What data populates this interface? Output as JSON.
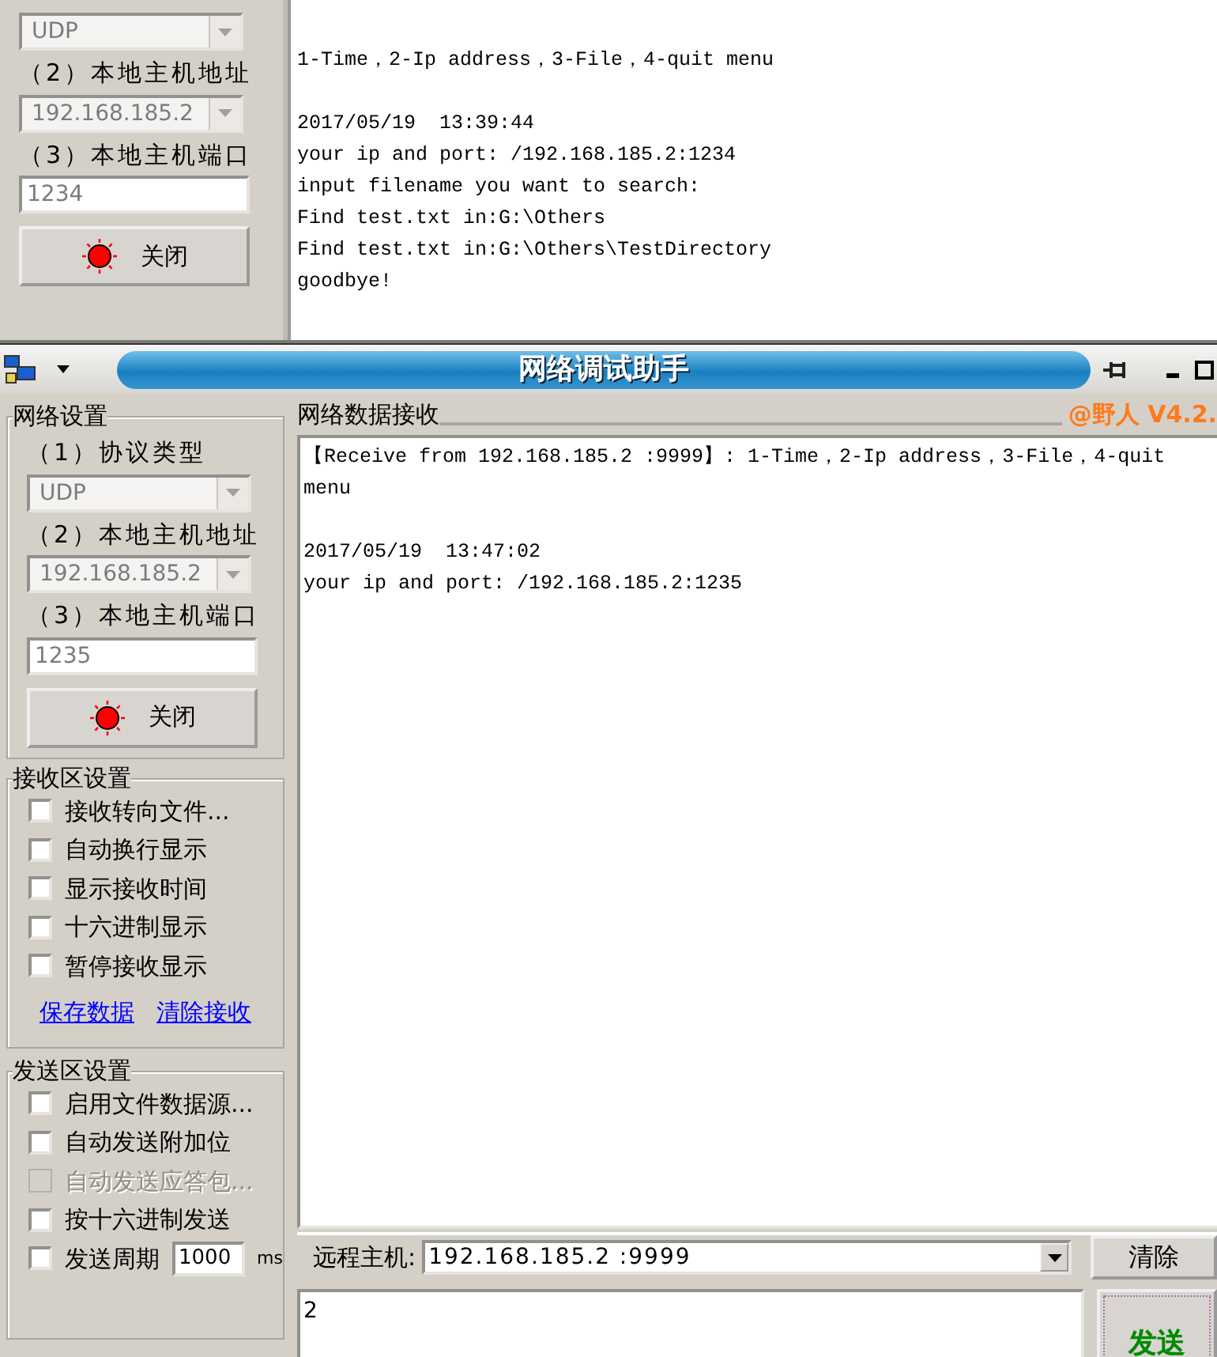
{
  "back_window": {
    "settings": [
      {
        "kind": "combo",
        "value": "UDP",
        "disabled": true
      },
      {
        "kind": "combo",
        "label": "（2）本地主机地址",
        "value": "192.168.185.2",
        "disabled": true
      },
      {
        "kind": "input",
        "label": "（3）本地主机端口",
        "value": "1234",
        "disabled": true
      }
    ],
    "toggle_button": {
      "label": "关闭",
      "on": true
    },
    "log": [
      [
        "1-Time，2-Ip address，3-File，4-quit menu"
      ],
      [
        "2017/05/19  13:39:44",
        "your ip and port: /192.168.185.2:1234",
        "input filename you want to search:",
        "Find test.txt in:G:\\Others",
        "Find test.txt in:G:\\Others\\TestDirectory",
        "goodbye!"
      ]
    ]
  },
  "front_window": {
    "title": "网络调试助手",
    "network_settings": {
      "title": "网络设置",
      "settings": [
        {
          "kind": "combo",
          "label": "（1）协议类型",
          "value": "UDP",
          "disabled": true
        },
        {
          "kind": "combo",
          "label": "（2）本地主机地址",
          "value": "192.168.185.2",
          "disabled": true
        },
        {
          "kind": "input",
          "label": "（3）本地主机端口",
          "value": "1235",
          "disabled": true
        }
      ],
      "toggle_button": {
        "label": "关闭",
        "on": true
      }
    },
    "receive_settings": {
      "title": "接收区设置",
      "options": [
        {
          "kind": "check",
          "label": "接收转向文件...",
          "checked": false,
          "disabled": false
        },
        {
          "kind": "check",
          "label": "自动换行显示",
          "checked": false,
          "disabled": false
        },
        {
          "kind": "check",
          "label": "显示接收时间",
          "checked": false,
          "disabled": false
        },
        {
          "kind": "check",
          "label": "十六进制显示",
          "checked": false,
          "disabled": false
        },
        {
          "kind": "check",
          "label": "暂停接收显示",
          "checked": false,
          "disabled": false
        }
      ],
      "links": [
        "保存数据",
        "清除接收"
      ]
    },
    "send_settings": {
      "title": "发送区设置",
      "options": [
        {
          "kind": "check",
          "label": "启用文件数据源...",
          "checked": false,
          "disabled": false
        },
        {
          "kind": "check",
          "label": "自动发送附加位",
          "checked": false,
          "disabled": false
        },
        {
          "kind": "check",
          "label": "自动发送应答包...",
          "checked": false,
          "disabled": true
        },
        {
          "kind": "check",
          "label": "按十六进制发送",
          "checked": false,
          "disabled": false
        },
        {
          "kind": "period",
          "label": "发送周期",
          "checked": false,
          "disabled": false,
          "value": "1000",
          "unit": "ms"
        }
      ]
    },
    "receive_area": {
      "title": "网络数据接收",
      "version": "@野人 V4.2.",
      "log": [
        [
          "【Receive from 192.168.185.2 :9999】: 1-Time，2-Ip address，3-File，4-quit menu"
        ],
        [
          "2017/05/19  13:47:02",
          "your ip and port: /192.168.185.2:1235"
        ]
      ]
    },
    "remote_host": {
      "label": "远程主机:",
      "value": "192.168.185.2 :9999"
    },
    "clear_button": "清除",
    "send_input": {
      "value": "2"
    },
    "send_button": "发送"
  }
}
